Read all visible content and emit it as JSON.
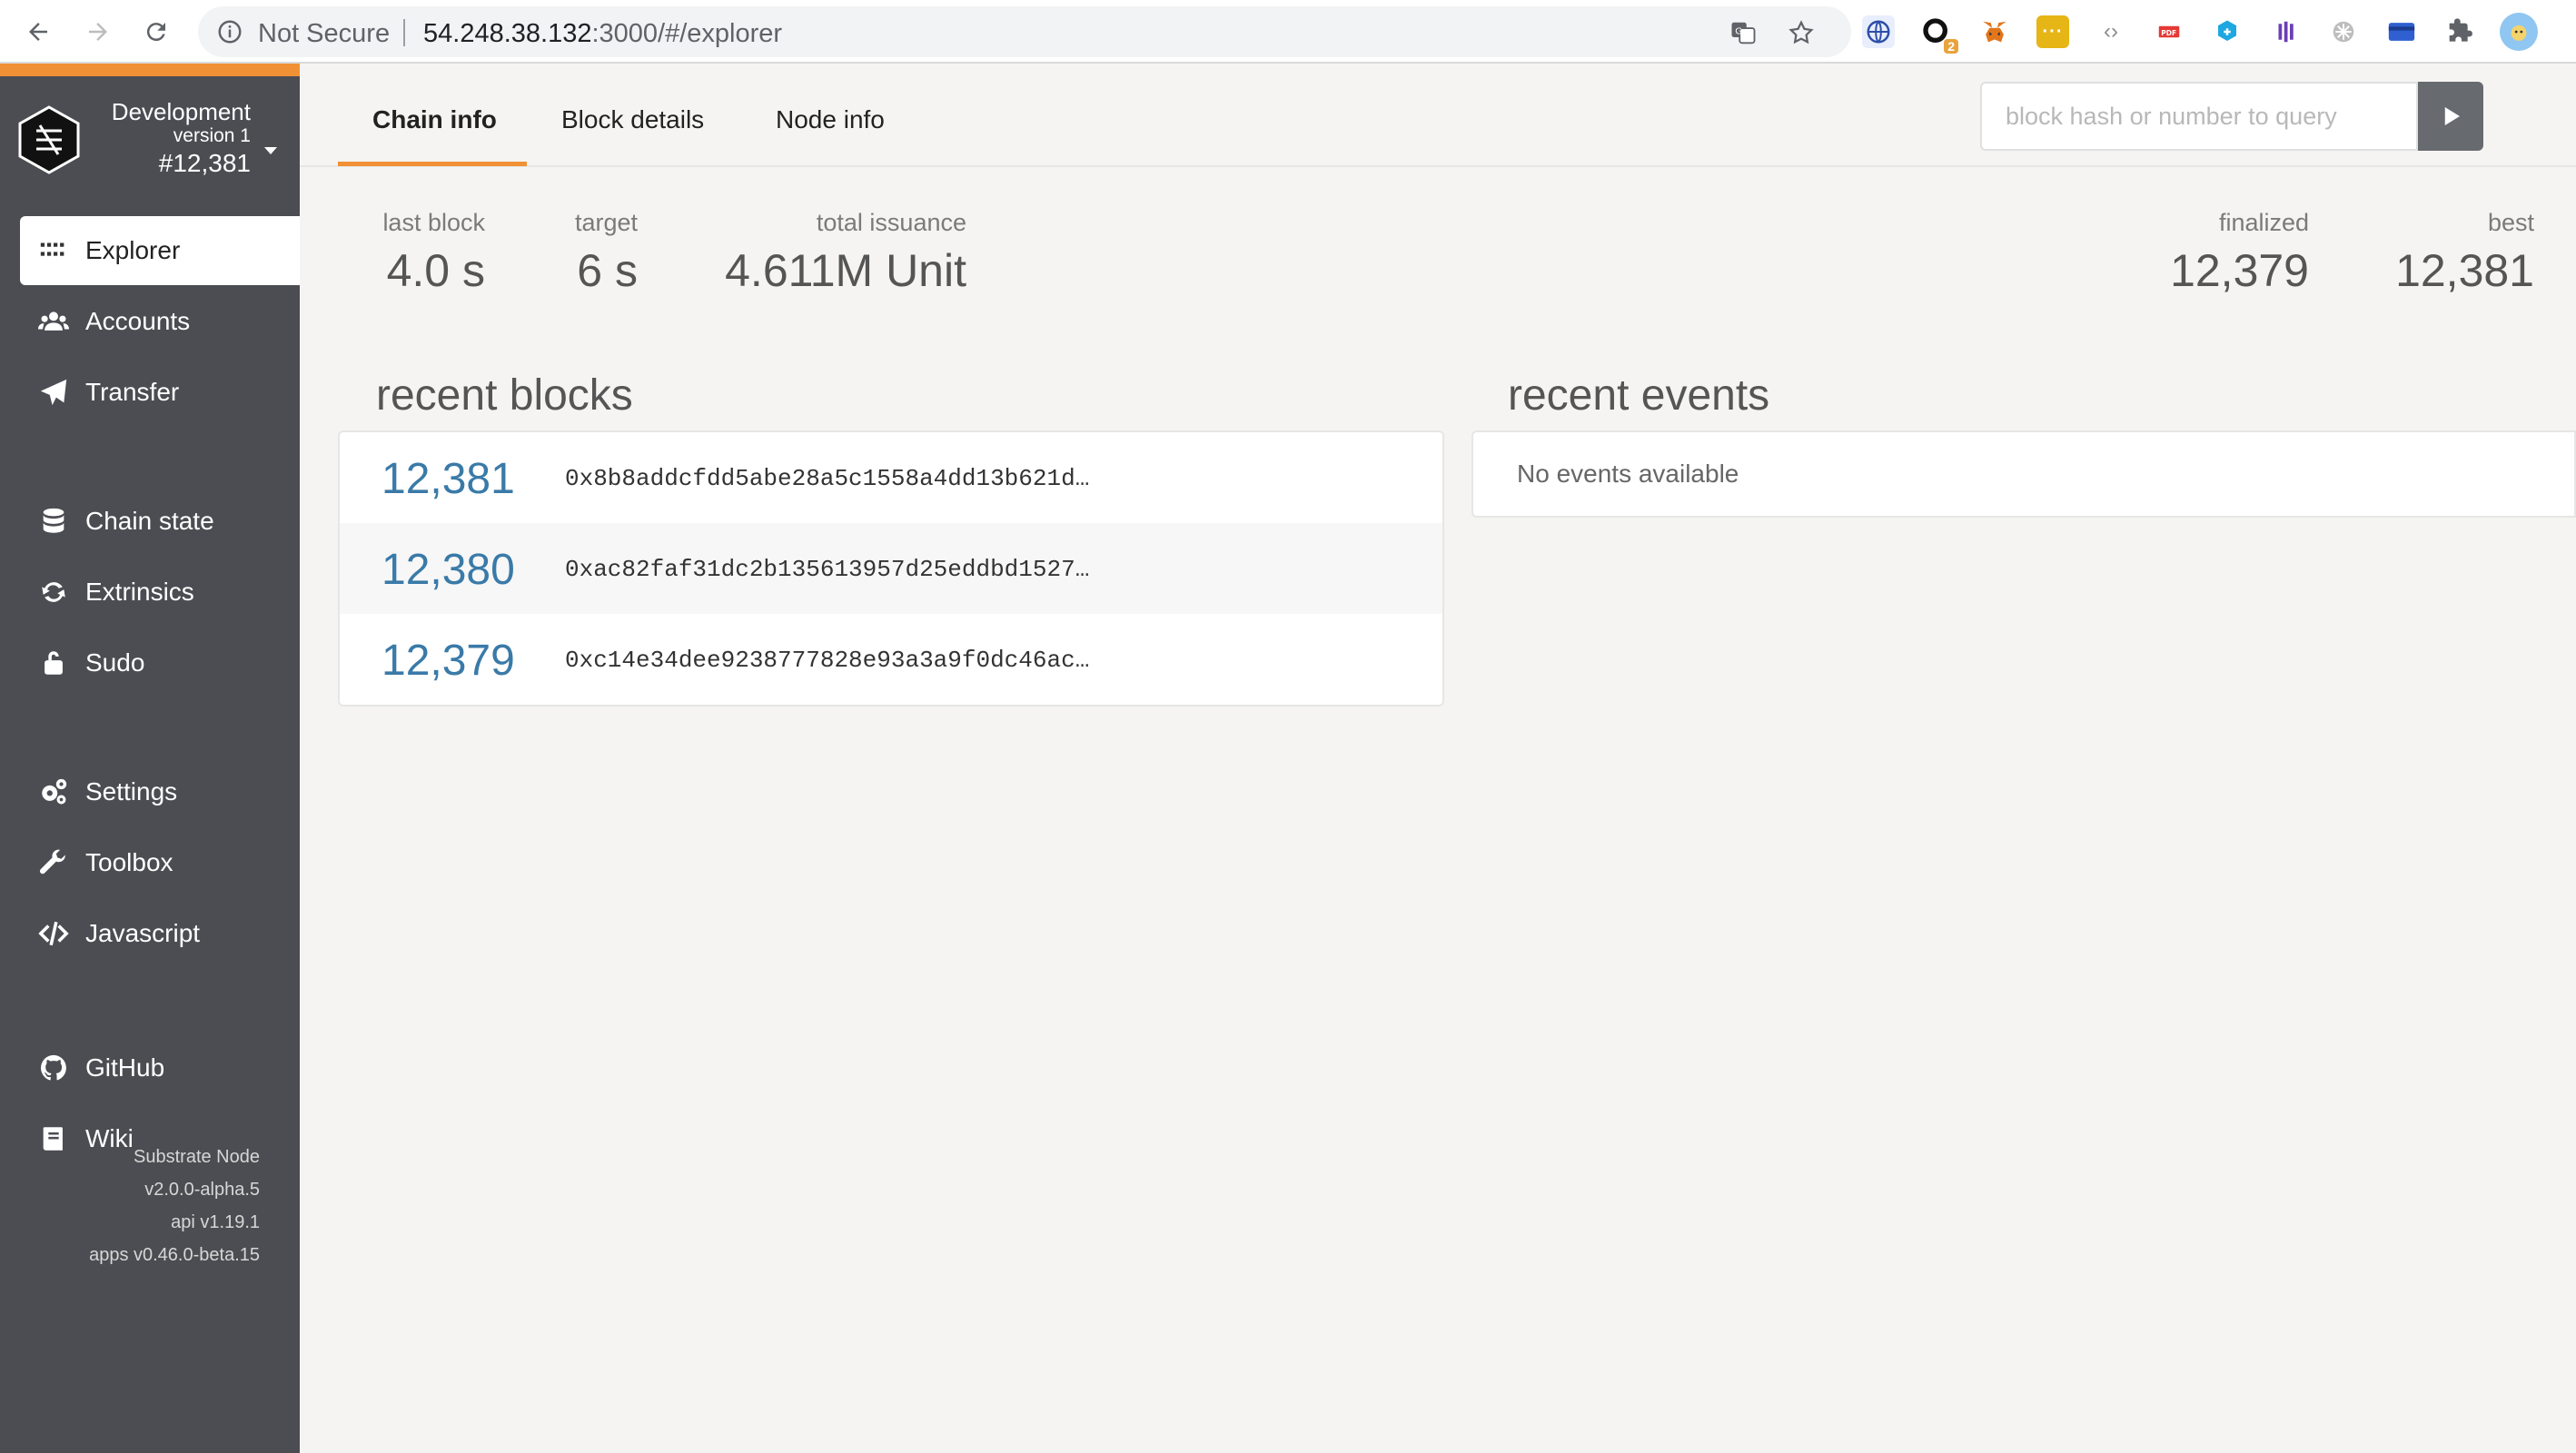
{
  "browser": {
    "not_secure_label": "Not Secure",
    "url_host": "54.248.38.132",
    "url_path": ":3000/#/explorer",
    "extension_badge": "2"
  },
  "sidebar": {
    "network": "Development",
    "version": "version 1",
    "block": "#12,381",
    "items": [
      {
        "label": "Explorer",
        "icon": "explorer-grid-icon"
      },
      {
        "label": "Accounts",
        "icon": "users-icon"
      },
      {
        "label": "Transfer",
        "icon": "paper-plane-icon"
      },
      {
        "label": "Chain state",
        "icon": "database-icon"
      },
      {
        "label": "Extrinsics",
        "icon": "sync-icon"
      },
      {
        "label": "Sudo",
        "icon": "unlock-icon"
      },
      {
        "label": "Settings",
        "icon": "cogs-icon"
      },
      {
        "label": "Toolbox",
        "icon": "wrench-icon"
      },
      {
        "label": "Javascript",
        "icon": "code-icon"
      },
      {
        "label": "GitHub",
        "icon": "github-icon"
      },
      {
        "label": "Wiki",
        "icon": "book-icon"
      }
    ],
    "footer": {
      "node": "Substrate Node",
      "node_version": "v2.0.0-alpha.5",
      "api": "api v1.19.1",
      "apps": "apps v0.46.0-beta.15"
    }
  },
  "tabs": [
    {
      "label": "Chain info",
      "active": true
    },
    {
      "label": "Block details",
      "active": false
    },
    {
      "label": "Node info",
      "active": false
    }
  ],
  "search": {
    "placeholder": "block hash or number to query",
    "value": ""
  },
  "stats": {
    "last_block": {
      "label": "last block",
      "value": "4.0 s"
    },
    "target": {
      "label": "target",
      "value": "6 s"
    },
    "total_issuance": {
      "label": "total issuance",
      "value": "4.611M Unit"
    },
    "finalized": {
      "label": "finalized",
      "value": "12,379"
    },
    "best": {
      "label": "best",
      "value": "12,381"
    }
  },
  "recent_blocks": {
    "title": "recent blocks",
    "rows": [
      {
        "number": "12,381",
        "hash": "0x8b8addcfdd5abe28a5c1558a4dd13b621d…"
      },
      {
        "number": "12,380",
        "hash": "0xac82faf31dc2b135613957d25eddbd1527…"
      },
      {
        "number": "12,379",
        "hash": "0xc14e34dee9238777828e93a3a9f0dc46ac…"
      }
    ]
  },
  "recent_events": {
    "title": "recent events",
    "empty_text": "No events available"
  },
  "colors": {
    "accent": "#f19135",
    "sidebar": "#4b4d52",
    "block_link": "#3a7aa8"
  }
}
